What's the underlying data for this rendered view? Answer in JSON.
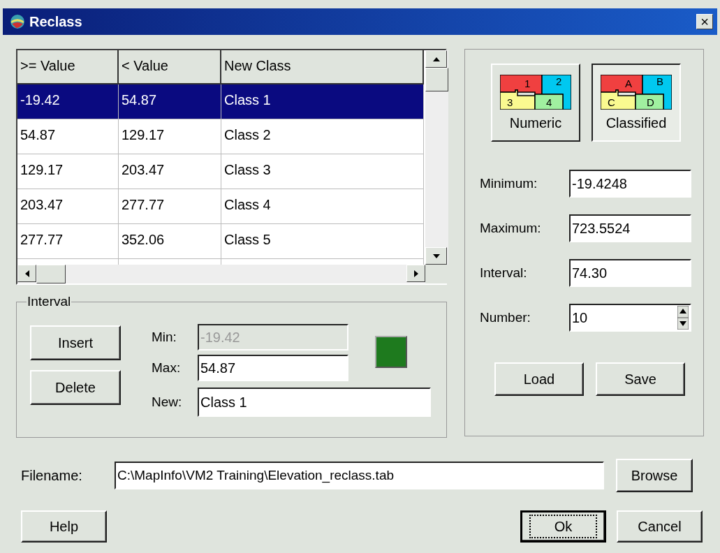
{
  "window": {
    "title": "Reclass",
    "close": "×"
  },
  "table": {
    "columns": [
      ">= Value",
      "< Value",
      "New Class"
    ],
    "rows": [
      {
        "cells": [
          "-19.42",
          "54.87",
          "Class 1"
        ],
        "selected": true
      },
      {
        "cells": [
          "54.87",
          "129.17",
          "Class 2"
        ],
        "selected": false
      },
      {
        "cells": [
          "129.17",
          "203.47",
          "Class 3"
        ],
        "selected": false
      },
      {
        "cells": [
          "203.47",
          "277.77",
          "Class 4"
        ],
        "selected": false
      },
      {
        "cells": [
          "277.77",
          "352.06",
          "Class 5"
        ],
        "selected": false
      }
    ]
  },
  "interval": {
    "title": "Interval",
    "buttons": [
      "Insert",
      "Delete"
    ],
    "color": "#1e7a1e",
    "fields": [
      {
        "label": "Min:",
        "value": "-19.42",
        "disabled": true
      },
      {
        "label": "Max:",
        "value": "54.87",
        "disabled": false
      },
      {
        "label": "New:",
        "value": "Class 1",
        "disabled": false
      }
    ]
  },
  "mode_buttons": [
    {
      "label": "Numeric",
      "selected": false,
      "glyphs": [
        "1",
        "2",
        "3",
        "4"
      ]
    },
    {
      "label": "Classified",
      "selected": true,
      "glyphs": [
        "A",
        "B",
        "C",
        "D"
      ]
    }
  ],
  "range_fields": [
    {
      "label": "Minimum:",
      "value": "-19.4248",
      "kind": "text"
    },
    {
      "label": "Maximum:",
      "value": "723.5524",
      "kind": "text"
    },
    {
      "label": "Interval:",
      "value": "74.30",
      "kind": "text"
    },
    {
      "label": "Number:",
      "value": "10",
      "kind": "spinner"
    }
  ],
  "range_buttons": [
    "Load",
    "Save"
  ],
  "filename": {
    "label": "Filename:",
    "value": "C:\\MapInfo\\VM2 Training\\Elevation_reclass.tab",
    "button": "Browse"
  },
  "buttons": [
    {
      "label": "Help",
      "default": false
    },
    {
      "label": "Ok",
      "default": true
    },
    {
      "label": "Cancel",
      "default": false
    }
  ]
}
